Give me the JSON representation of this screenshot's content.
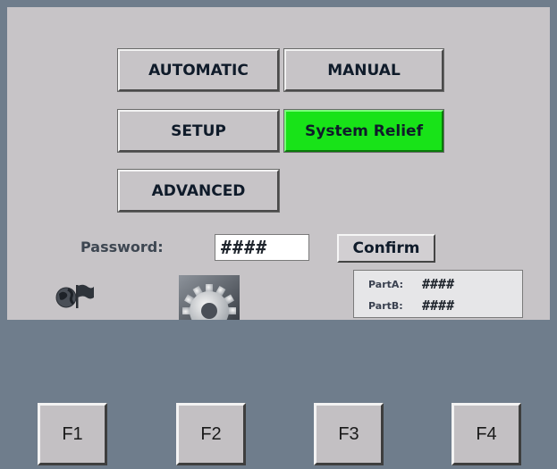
{
  "menu": {
    "automatic_label": "AUTOMATIC",
    "manual_label": "MANUAL",
    "setup_label": "SETUP",
    "system_relief_label": "System Relief",
    "advanced_label": "ADVANCED"
  },
  "password": {
    "label": "Password:",
    "value": "####",
    "confirm_label": "Confirm"
  },
  "parts": {
    "part_a_label": "PartA:",
    "part_a_value": "####",
    "part_b_label": "PartB:",
    "part_b_value": "####"
  },
  "function_keys": {
    "f1": "F1",
    "f2": "F2",
    "f3": "F3",
    "f4": "F4"
  },
  "colors": {
    "active_button": "#18e318",
    "panel_background": "#c7c4c7",
    "frame_background": "#6f7d8c"
  },
  "icons": {
    "language": "globe-flag-icon",
    "settings": "gear-icon"
  }
}
